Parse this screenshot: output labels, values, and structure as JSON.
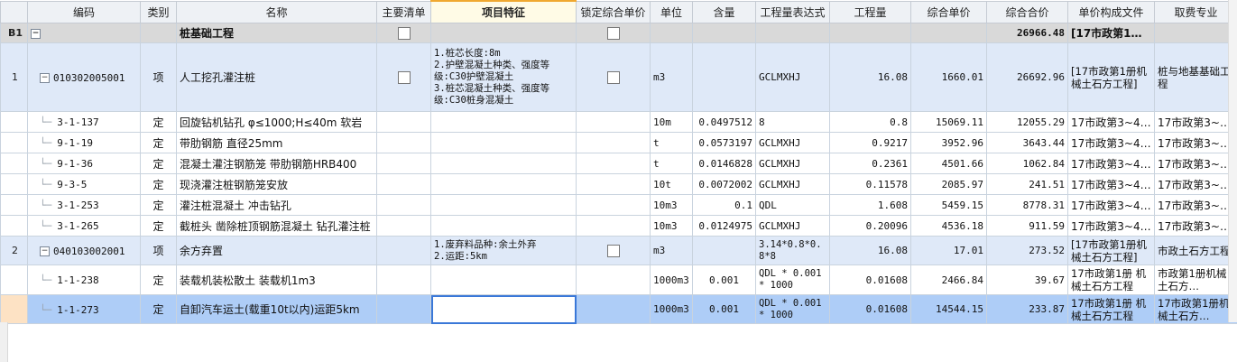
{
  "columns": [
    "编码",
    "类别",
    "名称",
    "主要清单",
    "项目特征",
    "锁定综合单价",
    "单位",
    "含量",
    "工程量表达式",
    "工程量",
    "综合单价",
    "综合合价",
    "单价构成文件",
    "取费专业"
  ],
  "section": {
    "rownum": "B1",
    "name": "桩基础工程",
    "total": "26966.48",
    "price_file": "[17市政第1…"
  },
  "items": [
    {
      "rownum": "1",
      "code": "010302005001",
      "type": "项",
      "name": "人工挖孔灌注桩",
      "features": "1.桩芯长度:8m\n2.护壁混凝土种类、强度等级:C30护壁混凝土\n3.桩芯混凝土种类、强度等级:C30桩身混凝土",
      "unit": "m3",
      "content": "",
      "expr": "GCLMXHJ",
      "qty": "16.08",
      "unit_price": "1660.01",
      "total": "26692.96",
      "price_file": "[17市政第1册机械土石方工程]",
      "fee_major": "桩与地基基础工程",
      "children": [
        {
          "code": "3-1-137",
          "type": "定",
          "name": "回旋钻机钻孔 φ≤1000;H≤40m 软岩",
          "unit": "10m",
          "content": "0.0497512",
          "expr": "8",
          "qty": "0.8",
          "unit_price": "15069.11",
          "total": "12055.29",
          "price_file": "17市政第3~4…",
          "fee_major": "17市政第3~…"
        },
        {
          "code": "9-1-19",
          "type": "定",
          "name": "带肋钢筋 直径25mm",
          "unit": "t",
          "content": "0.0573197",
          "expr": "GCLMXHJ",
          "qty": "0.9217",
          "unit_price": "3952.96",
          "total": "3643.44",
          "price_file": "17市政第3~4…",
          "fee_major": "17市政第3~…"
        },
        {
          "code": "9-1-36",
          "type": "定",
          "name": "混凝土灌注钢筋笼 带肋钢筋HRB400",
          "unit": "t",
          "content": "0.0146828",
          "expr": "GCLMXHJ",
          "qty": "0.2361",
          "unit_price": "4501.66",
          "total": "1062.84",
          "price_file": "17市政第3~4…",
          "fee_major": "17市政第3~…"
        },
        {
          "code": "9-3-5",
          "type": "定",
          "name": "现浇灌注桩钢筋笼安放",
          "unit": "10t",
          "content": "0.0072002",
          "expr": "GCLMXHJ",
          "qty": "0.11578",
          "unit_price": "2085.97",
          "total": "241.51",
          "price_file": "17市政第3~4…",
          "fee_major": "17市政第3~…"
        },
        {
          "code": "3-1-253",
          "type": "定",
          "name": "灌注桩混凝土 冲击钻孔",
          "unit": "10m3",
          "content": "0.1",
          "expr": "QDL",
          "qty": "1.608",
          "unit_price": "5459.15",
          "total": "8778.31",
          "price_file": "17市政第3~4…",
          "fee_major": "17市政第3~…"
        },
        {
          "code": "3-1-265",
          "type": "定",
          "name": "截桩头 凿除桩顶钢筋混凝土 钻孔灌注桩",
          "unit": "10m3",
          "content": "0.0124975",
          "expr": "GCLMXHJ",
          "qty": "0.20096",
          "unit_price": "4536.18",
          "total": "911.59",
          "price_file": "17市政第3~4…",
          "fee_major": "17市政第3~…"
        }
      ]
    },
    {
      "rownum": "2",
      "code": "040103002001",
      "type": "项",
      "name": "余方弃置",
      "features": "1.废弃料品种:余土外弃\n2.运距:5km",
      "unit": "m3",
      "content": "",
      "expr": "3.14*0.8*0.8*8",
      "qty": "16.08",
      "unit_price": "17.01",
      "total": "273.52",
      "price_file": "[17市政第1册机械土石方工程]",
      "fee_major": "市政土石方工程",
      "children": [
        {
          "code": "1-1-238",
          "type": "定",
          "name": "装载机装松散土 装载机1m3",
          "unit": "1000m3",
          "content": "0.001",
          "expr": "QDL * 0.001 * 1000",
          "qty": "0.01608",
          "unit_price": "2466.84",
          "total": "39.67",
          "price_file": "17市政第1册 机械土石方工程",
          "fee_major": "市政第1册机械土石方…"
        },
        {
          "code": "1-1-273",
          "type": "定",
          "name": "自卸汽车运土(载重10t以内)运距5km",
          "unit": "1000m3",
          "content": "0.001",
          "expr": "QDL * 0.001 * 1000",
          "qty": "0.01608",
          "unit_price": "14544.15",
          "total": "233.87",
          "price_file": "17市政第1册 机械土石方工程",
          "fee_major": "17市政第1册机械土石方…"
        }
      ]
    }
  ],
  "colors": {
    "section_bg": "#d9d9d9",
    "item_bg": "#dfe9f8",
    "selected_bg": "#aecdf7",
    "header_bg": "#eef1f5",
    "focus_border": "#3a78d8"
  }
}
